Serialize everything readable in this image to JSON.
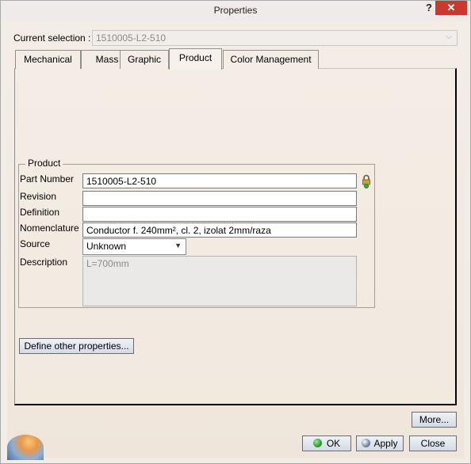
{
  "window": {
    "title": "Properties",
    "help_glyph": "?",
    "close_glyph": "✕"
  },
  "current_selection": {
    "label": "Current selection :",
    "value": "1510005-L2-510"
  },
  "tabs": [
    {
      "label": "Mechanical"
    },
    {
      "label": "Mass"
    },
    {
      "label": "Graphic"
    },
    {
      "label": "Product",
      "active": true
    },
    {
      "label": "Color Management"
    }
  ],
  "product": {
    "group_title": "Product",
    "part_number": {
      "label": "Part Number",
      "value": "1510005-L2-510"
    },
    "revision": {
      "label": "Revision",
      "value": ""
    },
    "definition": {
      "label": "Definition",
      "value": ""
    },
    "nomenclature": {
      "label": "Nomenclature",
      "value": "Conductor f. 240mm², cl. 2, izolat 2mm/raza"
    },
    "source": {
      "label": "Source",
      "value": "Unknown"
    },
    "description": {
      "label": "Description",
      "value": "L=700mm"
    }
  },
  "buttons": {
    "define_other": "Define other properties...",
    "more": "More...",
    "ok": "OK",
    "apply": "Apply",
    "close": "Close"
  },
  "icons": {
    "lock": "lock-icon",
    "ok": "green-circle-icon",
    "apply": "globe-icon",
    "corner": "catia-logo-icon"
  }
}
